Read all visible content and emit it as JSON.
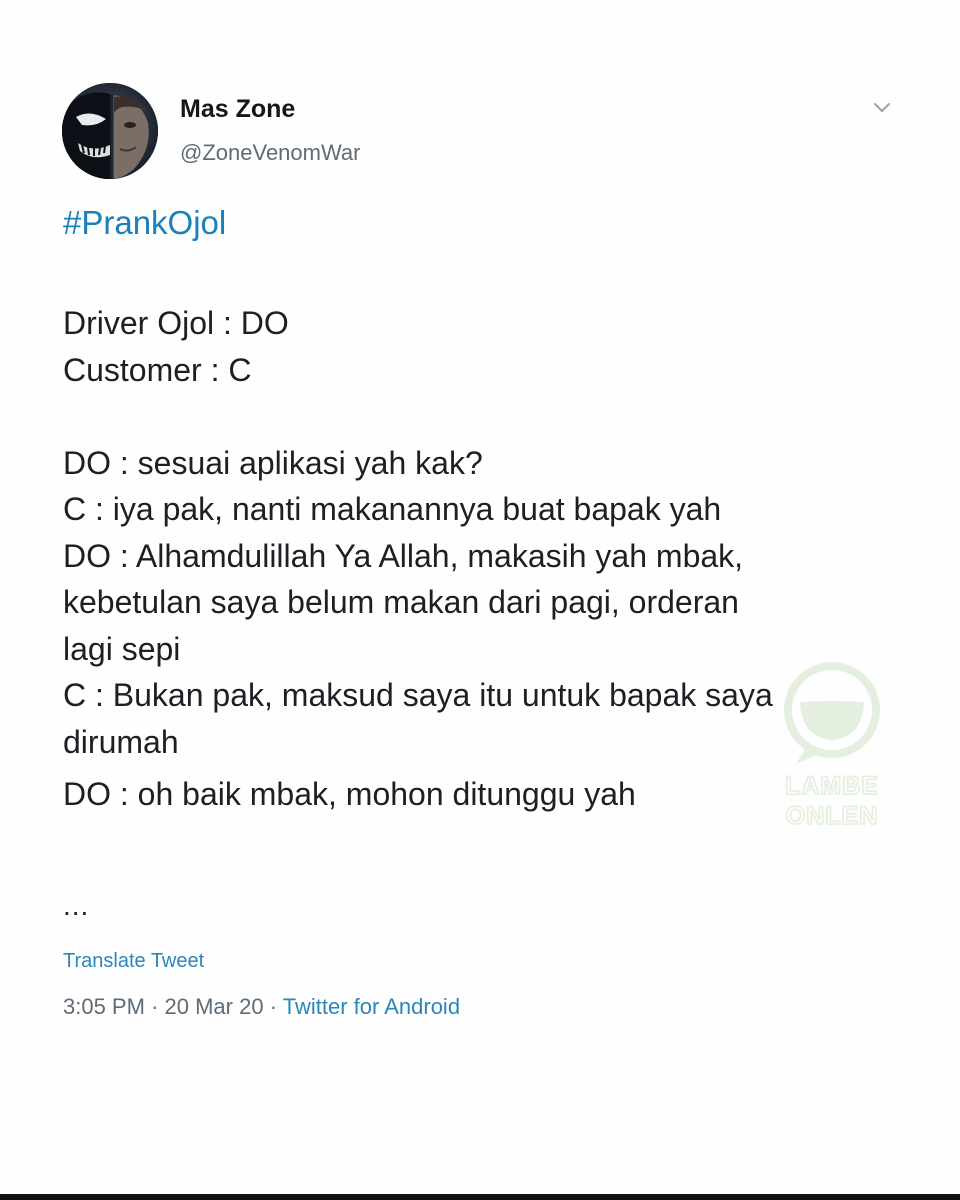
{
  "author": {
    "display_name": "Mas Zone",
    "handle": "@ZoneVenomWar",
    "avatar_icon": "venom-avatar-icon"
  },
  "tweet": {
    "hashtag": "#PrankOjol",
    "lines": [
      "Driver Ojol : DO",
      "Customer : C",
      "DO : sesuai aplikasi yah kak?",
      "C : iya pak, nanti makanannya buat bapak yah",
      "DO : Alhamdulillah Ya Allah, makasih yah mbak,",
      "kebetulan saya belum makan dari pagi, orderan",
      "lagi sepi",
      "C : Bukan pak, maksud saya itu untuk bapak saya",
      "dirumah",
      "DO : oh baik mbak, mohon ditunggu yah"
    ],
    "ellipsis": "...",
    "translate_label": "Translate Tweet",
    "time": "3:05 PM",
    "date": "20 Mar 20",
    "separator": "·",
    "source": "Twitter for Android"
  },
  "watermark": {
    "line1": "LAMBE",
    "line2": "ONLEN"
  },
  "colors": {
    "link": "#1b80b8",
    "secondary_text": "#5f6b76",
    "watermark_green": "#c5ddba"
  }
}
